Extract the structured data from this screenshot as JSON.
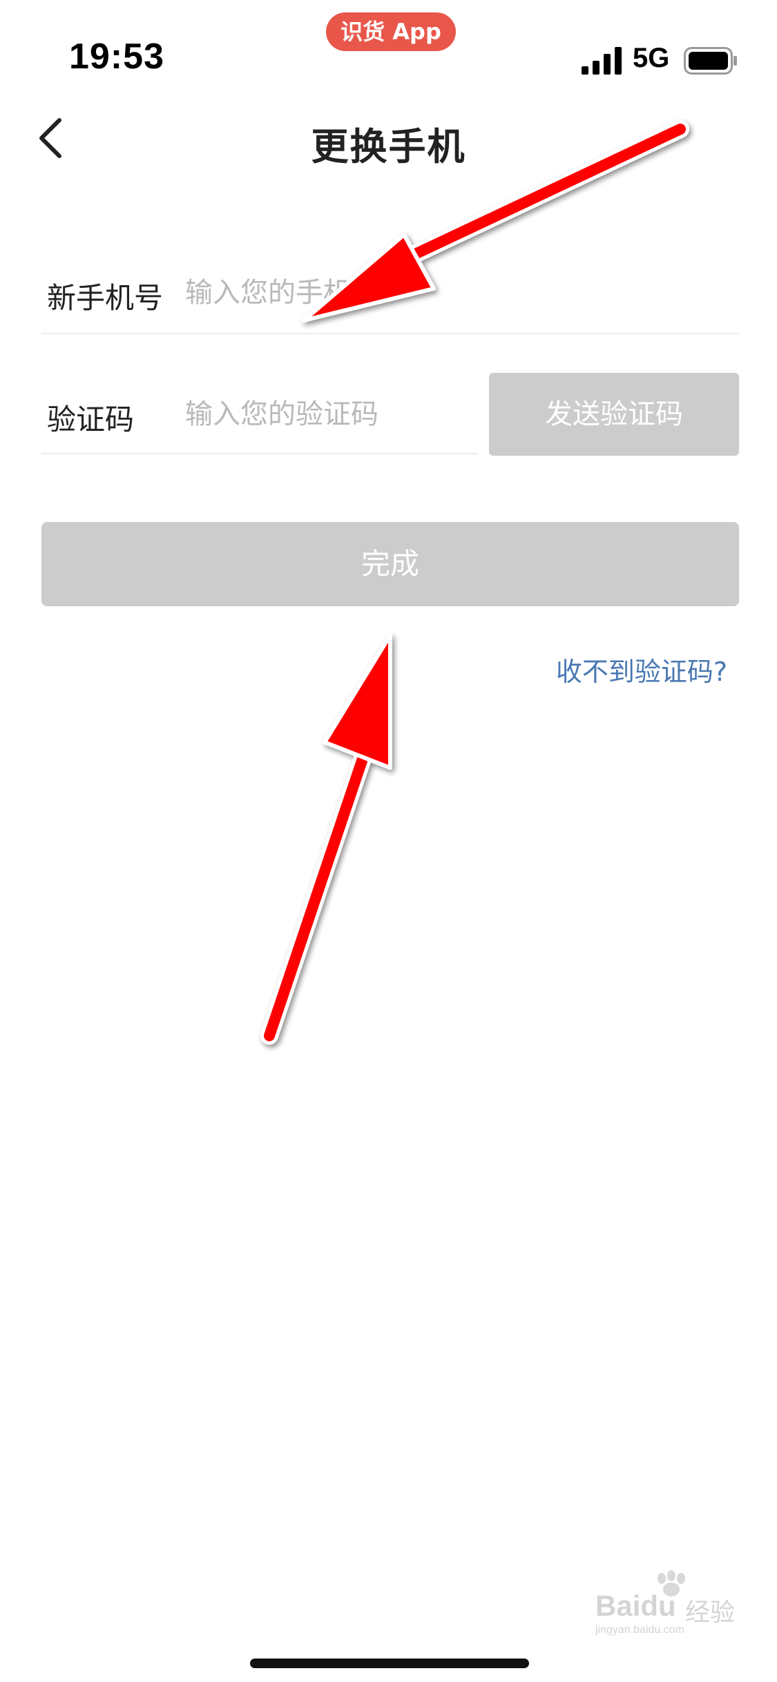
{
  "status_bar": {
    "time": "19:53",
    "app_pill": "识货 App",
    "network": "5G",
    "icons": [
      "signal-icon",
      "battery-icon"
    ]
  },
  "nav": {
    "back_icon": "chevron-left-icon",
    "title": "更换手机"
  },
  "form": {
    "phone": {
      "label": "新手机号",
      "placeholder": "输入您的手机号",
      "value": ""
    },
    "code": {
      "label": "验证码",
      "placeholder": "输入您的验证码",
      "value": ""
    },
    "send_code_label": "发送验证码",
    "done_label": "完成",
    "no_code_link": "收不到验证码?"
  },
  "colors": {
    "pill": "#e8574a",
    "disabled_button": "#cccccc",
    "link": "#4a78b3",
    "annotation_arrow": "#ff0000"
  },
  "watermark": {
    "brand": "Baidu",
    "suffix": "经验",
    "site": "jingyan.baidu.com"
  }
}
